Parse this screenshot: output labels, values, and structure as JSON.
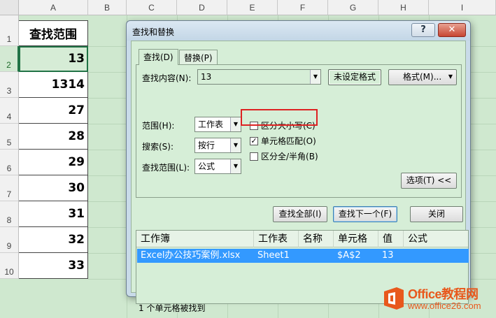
{
  "sheet": {
    "columns": [
      "A",
      "B",
      "C",
      "D",
      "E",
      "F",
      "G",
      "H",
      "I"
    ],
    "rows": [
      "1",
      "2",
      "3",
      "4",
      "5",
      "6",
      "7",
      "8",
      "9",
      "10"
    ],
    "cells": [
      "查找范围",
      "13",
      "1314",
      "27",
      "28",
      "29",
      "30",
      "31",
      "32",
      "33"
    ]
  },
  "dialog": {
    "title": "查找和替换",
    "help": "?",
    "close": "✕",
    "tabs": {
      "find": "查找(D)",
      "replace": "替换(P)"
    },
    "find_what_label": "查找内容(N):",
    "find_what_value": "13",
    "format_status": "未设定格式",
    "format_button": "格式(M)...",
    "scope_label": "范围(H):",
    "scope_value": "工作表",
    "search_label": "搜索(S):",
    "search_value": "按行",
    "lookin_label": "查找范围(L):",
    "lookin_value": "公式",
    "match_case": {
      "label": "区分大小写(C)",
      "checked": false
    },
    "match_entire": {
      "label": "单元格匹配(O)",
      "checked": true
    },
    "match_byte": {
      "label": "区分全/半角(B)",
      "checked": false
    },
    "options_button": "选项(T) <<",
    "find_all_button": "查找全部(I)",
    "find_next_button": "查找下一个(F)",
    "close_button": "关闭",
    "results": {
      "columns": [
        "工作簿",
        "工作表",
        "名称",
        "单元格",
        "值",
        "公式"
      ],
      "row": [
        "Excel办公技巧案例.xlsx",
        "Sheet1",
        "",
        "$A$2",
        "13",
        ""
      ]
    },
    "status": "1 个单元格被找到"
  },
  "watermark": {
    "name": "Office教程网",
    "url": "www.office26.com"
  },
  "colors": {
    "excel_green": "#217346",
    "selection_blue": "#3399ff",
    "highlight_red": "#dd2222",
    "brand_orange": "#e8581c"
  }
}
